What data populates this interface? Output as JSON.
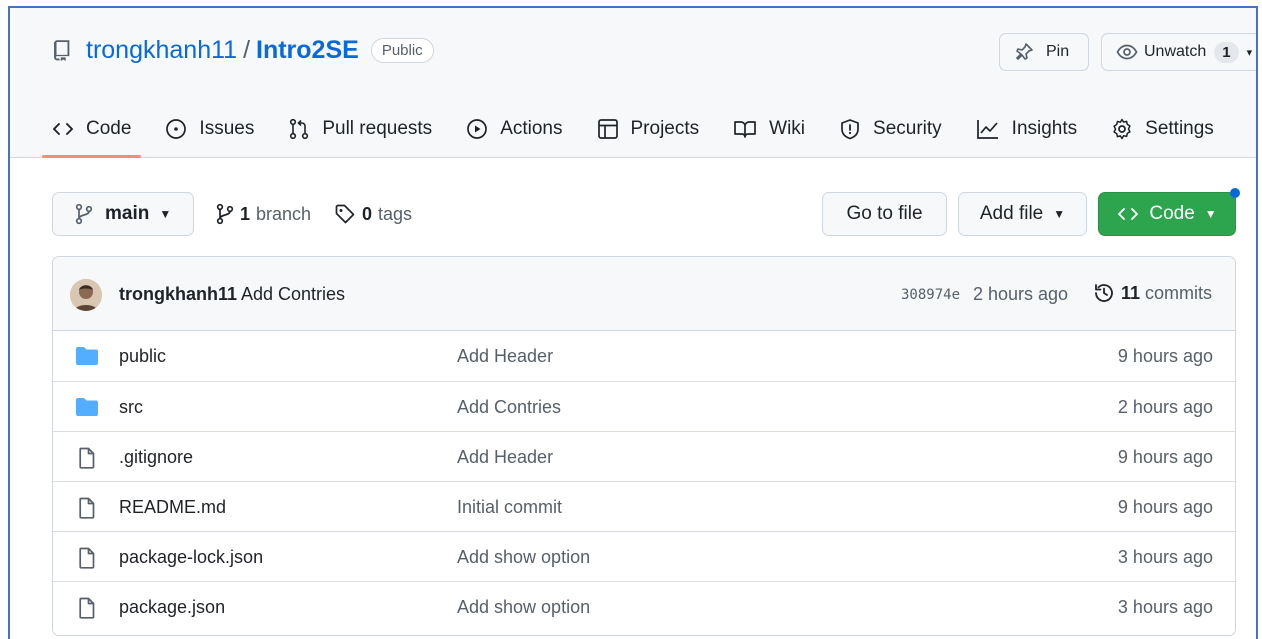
{
  "repo": {
    "owner": "trongkhanh11",
    "separator": "/",
    "name": "Intro2SE",
    "visibility": "Public"
  },
  "header_actions": {
    "pin_label": "Pin",
    "unwatch_label": "Unwatch",
    "watch_count": "1"
  },
  "tabs": [
    {
      "label": "Code",
      "icon": "code-icon",
      "active": true
    },
    {
      "label": "Issues",
      "icon": "issue-icon"
    },
    {
      "label": "Pull requests",
      "icon": "pull-request-icon"
    },
    {
      "label": "Actions",
      "icon": "play-icon"
    },
    {
      "label": "Projects",
      "icon": "table-icon"
    },
    {
      "label": "Wiki",
      "icon": "book-icon"
    },
    {
      "label": "Security",
      "icon": "shield-icon"
    },
    {
      "label": "Insights",
      "icon": "graph-icon"
    },
    {
      "label": "Settings",
      "icon": "gear-icon"
    }
  ],
  "toolbar": {
    "branch": "main",
    "branch_count": "1",
    "branch_word": "branch",
    "tag_count": "0",
    "tag_word": "tags",
    "goto_file": "Go to file",
    "add_file": "Add file",
    "code": "Code"
  },
  "latest_commit": {
    "author": "trongkhanh11",
    "message": "Add Contries",
    "sha": "308974e",
    "time": "2 hours ago",
    "commit_count": "11",
    "commit_word": "commits"
  },
  "files": [
    {
      "type": "dir",
      "name": "public",
      "message": "Add Header",
      "time": "9 hours ago"
    },
    {
      "type": "dir",
      "name": "src",
      "message": "Add Contries",
      "time": "2 hours ago"
    },
    {
      "type": "file",
      "name": ".gitignore",
      "message": "Add Header",
      "time": "9 hours ago"
    },
    {
      "type": "file",
      "name": "README.md",
      "message": "Initial commit",
      "time": "9 hours ago"
    },
    {
      "type": "file",
      "name": "package-lock.json",
      "message": "Add show option",
      "time": "3 hours ago"
    },
    {
      "type": "file",
      "name": "package.json",
      "message": "Add show option",
      "time": "3 hours ago"
    }
  ],
  "colors": {
    "link": "#0969da",
    "primary_button": "#2da44e",
    "tab_underline": "#fd8c73",
    "folder": "#54aeff"
  }
}
